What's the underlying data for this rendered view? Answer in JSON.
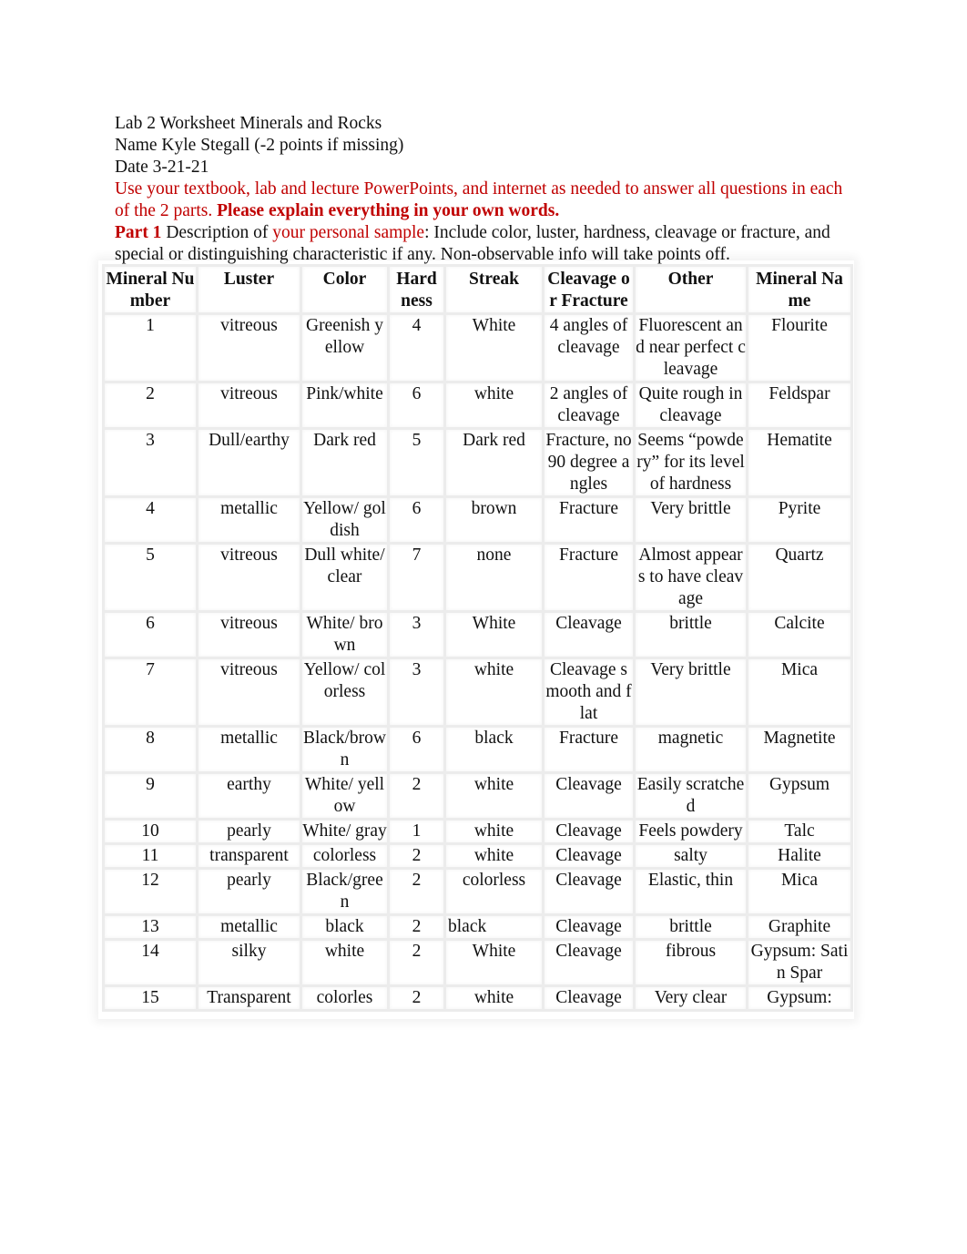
{
  "header": {
    "title": "Lab 2 Worksheet Minerals and Rocks",
    "name_line": "Name Kyle Stegall (-2 points if missing)",
    "date_line": "Date 3-21-21"
  },
  "instructions": {
    "red_text": "Use your textbook, lab and lecture PowerPoints, and internet as needed to answer all questions in each of the 2 parts. ",
    "red_bold_text": "Please explain everything in your own words."
  },
  "part1": {
    "label": "Part 1",
    "text_a": " Description of ",
    "text_red": "your personal sample",
    "text_b": ": Include color, luster, hardness, cleavage or fracture, and special or distinguishing characteristic if any. Non-observable info will take points off."
  },
  "table": {
    "columns": [
      "Mineral Number",
      "Luster",
      "Color",
      "Hard ness",
      "Streak",
      "Cleavage or Fracture",
      "Other",
      "Mineral Name"
    ],
    "rows": [
      [
        "1",
        "vitreous",
        "Greenish yellow",
        "4",
        "White",
        "4 angles of cleavage",
        "Fluorescent and near perfect cleavage",
        "Flourite"
      ],
      [
        "2",
        "vitreous",
        "Pink/white",
        "6",
        "white",
        "2 angles of cleavage",
        "Quite rough in cleavage",
        "Feldspar"
      ],
      [
        "3",
        "Dull/earthy",
        "Dark red",
        "5",
        "Dark red",
        "Fracture, no 90 degree angles",
        "Seems “powdery” for its level of hardness",
        "Hematite"
      ],
      [
        "4",
        "metallic",
        "Yellow/ goldish",
        "6",
        "brown",
        "Fracture",
        "Very brittle",
        "Pyrite"
      ],
      [
        "5",
        "vitreous",
        "Dull white/clear",
        "7",
        "none",
        "Fracture",
        "Almost appears to have cleavage",
        "Quartz"
      ],
      [
        "6",
        "vitreous",
        "White/ brown",
        "3",
        "White",
        "Cleavage",
        "brittle",
        "Calcite"
      ],
      [
        "7",
        "vitreous",
        "Yellow/ colorless",
        "3",
        "white",
        "Cleavage smooth and flat",
        "Very brittle",
        "Mica"
      ],
      [
        "8",
        "metallic",
        "Black/brown",
        "6",
        "black",
        "Fracture",
        "magnetic",
        "Magnetite"
      ],
      [
        "9",
        "earthy",
        "White/ yellow",
        "2",
        "white",
        "Cleavage",
        "Easily scratched",
        "Gypsum"
      ],
      [
        "10",
        "pearly",
        "White/ gray",
        "1",
        "white",
        "Cleavage",
        "Feels powdery",
        "Talc"
      ],
      [
        "11",
        "transparent",
        "colorless",
        "2",
        "white",
        "Cleavage",
        "salty",
        "Halite"
      ],
      [
        "12",
        "pearly",
        "Black/green",
        "2",
        "colorless",
        "Cleavage",
        "Elastic, thin",
        "Mica"
      ],
      [
        "13",
        "metallic",
        "black",
        "2",
        "black",
        "Cleavage",
        "brittle",
        "Graphite"
      ],
      [
        "14",
        "silky",
        "white",
        "2",
        "White",
        "Cleavage",
        "fibrous",
        "Gypsum: Satin Spar"
      ],
      [
        "15",
        "Transparent",
        "colorles",
        "2",
        "white",
        "Cleavage",
        "Very clear",
        "Gypsum:"
      ]
    ]
  }
}
